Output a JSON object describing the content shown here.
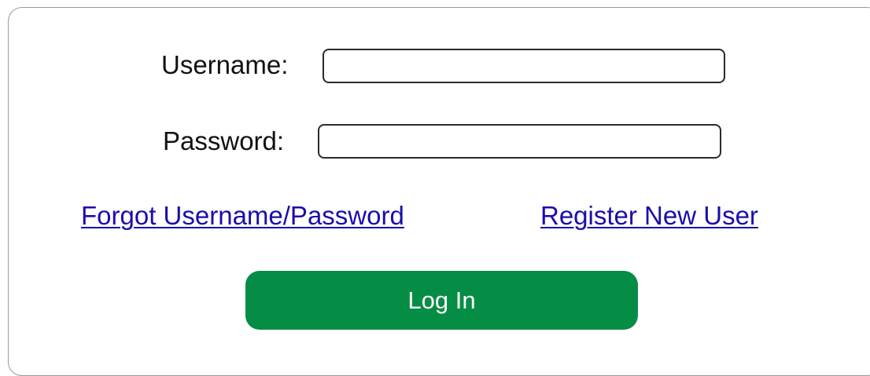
{
  "form": {
    "username_label": "Username:",
    "username_value": "",
    "password_label": "Password:",
    "password_value": "",
    "forgot_link": "Forgot Username/Password",
    "register_link": "Register New User",
    "login_button": "Log In"
  },
  "colors": {
    "accent": "#068d45",
    "link": "#1a0dab",
    "border": "#9a9a9a"
  }
}
